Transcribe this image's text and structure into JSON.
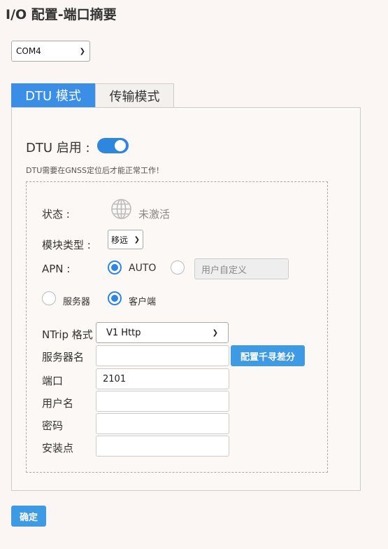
{
  "page": {
    "title": "I/O 配置-端口摘要"
  },
  "port_select": {
    "value": "COM4"
  },
  "tabs": [
    {
      "label": "DTU 模式"
    },
    {
      "label": "传输模式"
    }
  ],
  "dtu": {
    "enable_label": "DTU 启用 :",
    "enabled": true,
    "note": "DTU需要在GNSS定位后才能正常工作！"
  },
  "status": {
    "label": "状态 :",
    "value": "未激活"
  },
  "module": {
    "label": "模块类型 :",
    "value": "移远"
  },
  "apn": {
    "label": "APN :",
    "option_auto": "AUTO",
    "custom_placeholder": "用户自定义"
  },
  "role": {
    "server": "服务器",
    "client": "客户端"
  },
  "ntrip": {
    "format_label": "NTrip 格式",
    "format_value": "V1 Http",
    "server_name_label": "服务器名",
    "server_name_value": "",
    "qianxun_button": "配置千寻差分",
    "port_label": "端口",
    "port_value": "2101",
    "username_label": "用户名",
    "username_value": "",
    "password_label": "密码",
    "password_value": "",
    "mountpoint_label": "安装点",
    "mountpoint_value": ""
  },
  "confirm_button": "确定"
}
